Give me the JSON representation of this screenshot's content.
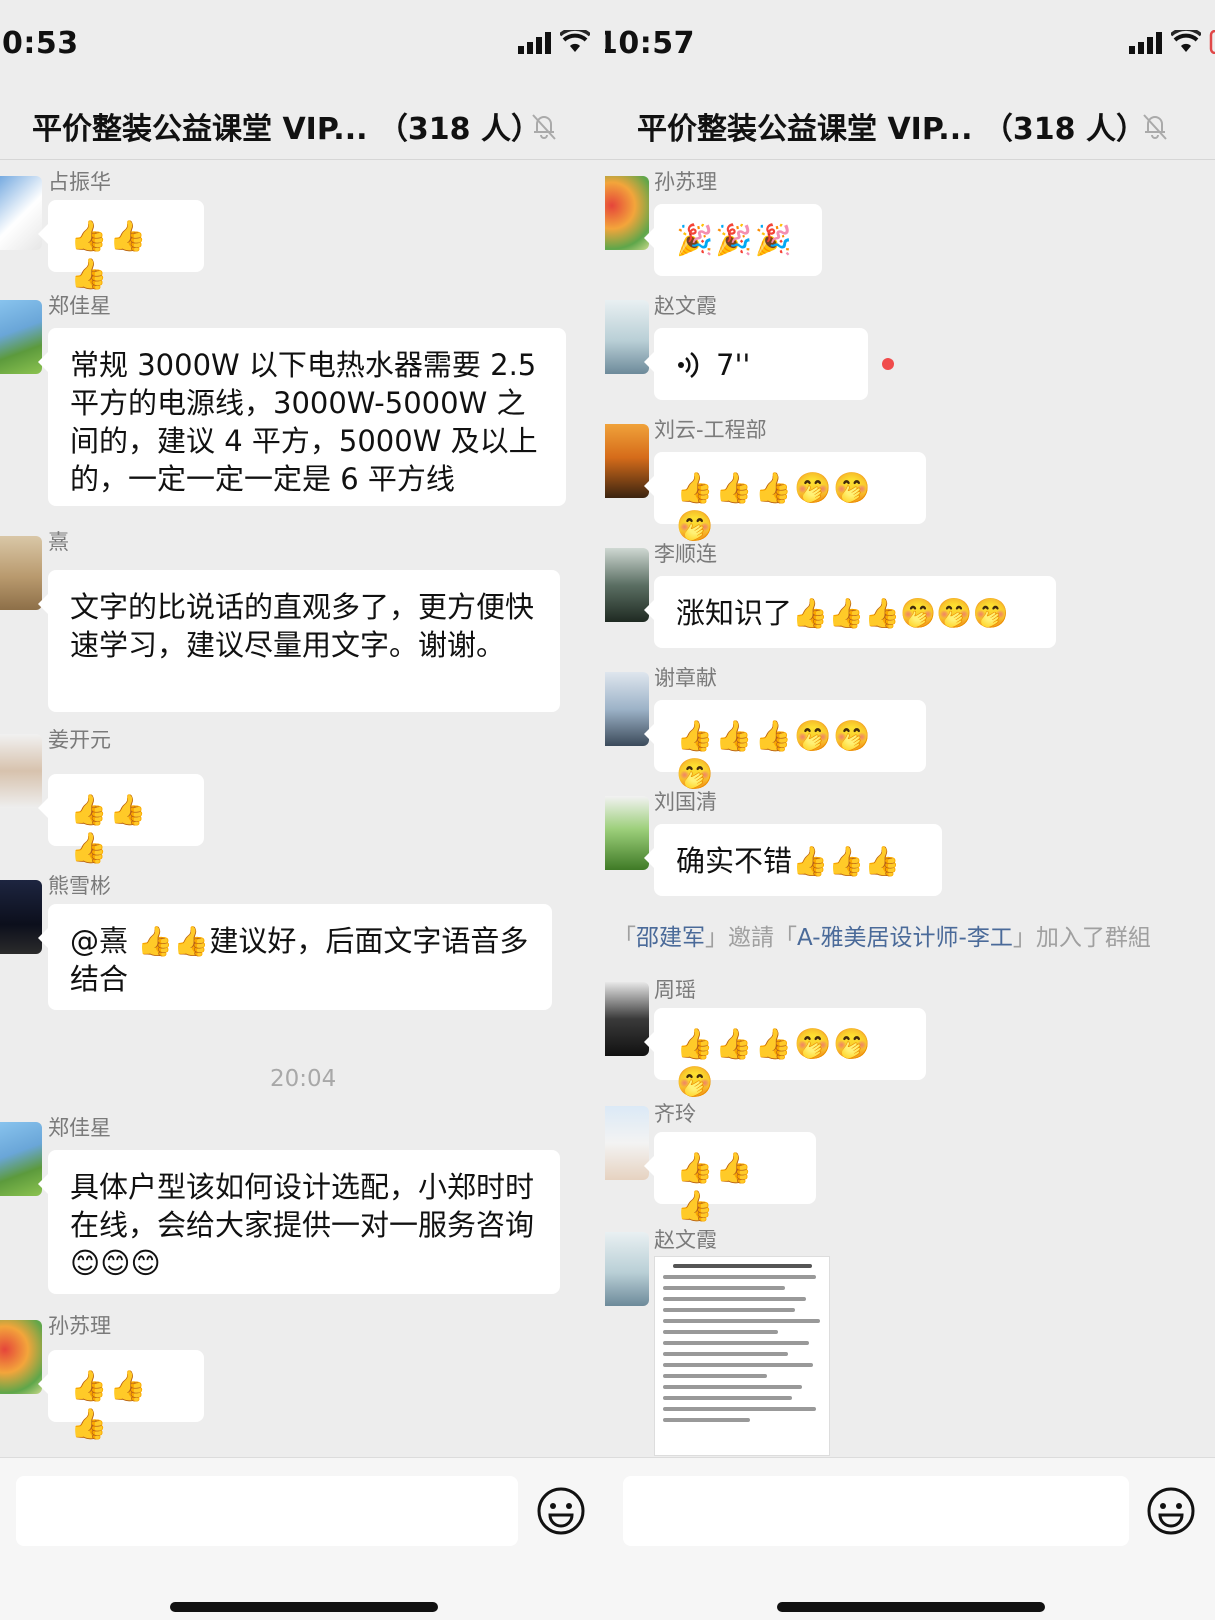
{
  "left": {
    "status_time": "0:53",
    "chat_title": "平价整装公益课堂 VIP...  （318 人）",
    "messages": [
      {
        "sender": "占振华",
        "text": "👍👍👍"
      },
      {
        "sender": "郑佳星",
        "text": "常规 3000W 以下电热水器需要 2.5 平方的电源线，3000W-5000W 之间的，建议 4 平方，5000W 及以上的，一定一定一定是 6 平方线"
      },
      {
        "sender": "熹",
        "text": "文字的比说话的直观多了，更方便快速学习，建议尽量用文字。谢谢。"
      },
      {
        "sender": "姜开元",
        "text": "👍👍👍"
      },
      {
        "sender": "熊雪彬",
        "text": "@熹 👍👍建议好，后面文字语音多结合"
      },
      {
        "sender": "郑佳星",
        "text": "具体户型该如何设计选配，小郑时时在线，会给大家提供一对一服务咨询😊😊😊"
      },
      {
        "sender": "孙苏理",
        "text": "👍👍👍"
      }
    ],
    "timestamp": "20:04"
  },
  "right": {
    "status_time": "10:57",
    "chat_title": "平价整装公益课堂 VIP...  （318 人）",
    "messages": [
      {
        "sender": "孙苏理",
        "text": "🎉🎉🎉"
      },
      {
        "sender": "赵文霞",
        "text": "7''"
      },
      {
        "sender": "刘云-工程部",
        "text": "👍👍👍🤭🤭🤭"
      },
      {
        "sender": "李顺连",
        "text": "涨知识了👍👍👍🤭🤭🤭"
      },
      {
        "sender": "谢章献",
        "text": "👍👍👍🤭🤭🤭"
      },
      {
        "sender": "刘国清",
        "text": "确实不错👍👍👍"
      },
      {
        "sender": "周瑶",
        "text": "👍👍👍🤭🤭🤭"
      },
      {
        "sender": "齐玲",
        "text": "👍👍👍"
      },
      {
        "sender": "赵文霞",
        "text": ""
      }
    ],
    "system": {
      "q1": "「",
      "inviter": "邵建军",
      "mid": "」邀請「",
      "invitee": "A-雅美居设计师-李工",
      "end": "」加入了群組"
    }
  },
  "colors": {
    "background": "#ededed",
    "bubble": "#ffffff",
    "sender_name": "#7a7a7a",
    "system_name": "#4a6a99",
    "unread_dot": "#f04b4b"
  },
  "icons": {
    "mute": "bell-slash-icon",
    "voice": "sound-wave-icon",
    "emoji_button": "smiley-face-icon",
    "signal": "signal-bars-icon",
    "wifi": "wifi-icon",
    "battery": "battery-icon"
  }
}
